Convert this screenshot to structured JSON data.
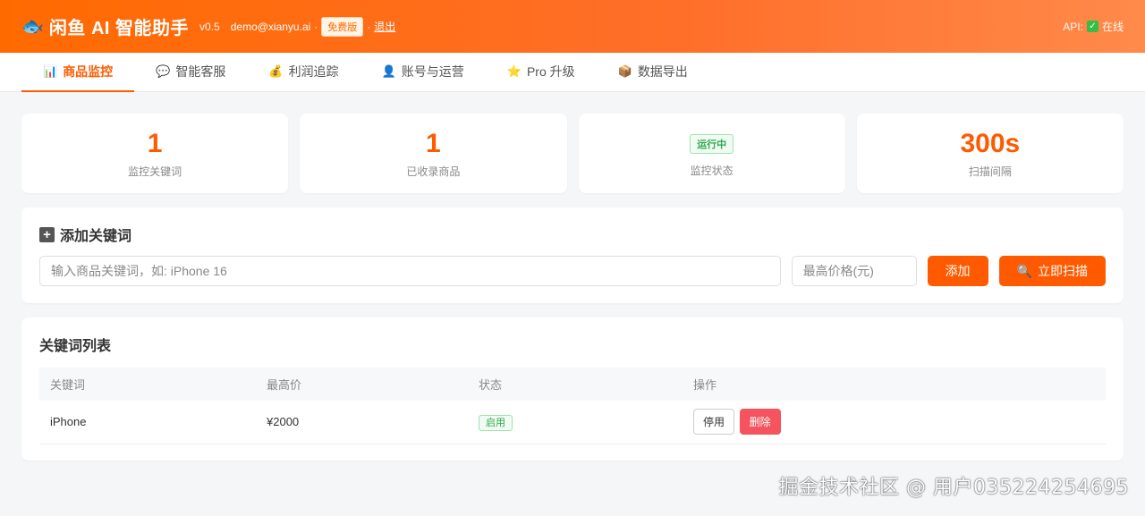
{
  "header": {
    "logo_icon": "fish-icon",
    "app_title": "闲鱼 AI 智能助手",
    "version": "v0.5",
    "email": "demo@xianyu.ai",
    "separator": "·",
    "plan_badge": "免费版",
    "logout_label": "退出",
    "api_label": "API:",
    "api_status": "在线",
    "api_icon": "check-icon"
  },
  "tabs": [
    {
      "icon": "📊",
      "icon_name": "chart-icon",
      "label": "商品监控",
      "active": true
    },
    {
      "icon": "💬",
      "icon_name": "chat-icon",
      "label": "智能客服",
      "active": false
    },
    {
      "icon": "💰",
      "icon_name": "money-bag-icon",
      "label": "利润追踪",
      "active": false
    },
    {
      "icon": "👤",
      "icon_name": "user-icon",
      "label": "账号与运营",
      "active": false
    },
    {
      "icon": "⭐",
      "icon_name": "star-icon",
      "label": "Pro 升级",
      "active": false
    },
    {
      "icon": "📦",
      "icon_name": "package-icon",
      "label": "数据导出",
      "active": false
    }
  ],
  "stats": [
    {
      "value": "1",
      "label": "监控关键词"
    },
    {
      "value": "1",
      "label": "已收录商品"
    },
    {
      "badge": "运行中",
      "label": "监控状态"
    },
    {
      "value": "300s",
      "label": "扫描间隔"
    }
  ],
  "add_keyword": {
    "title_icon": "plus-icon",
    "title": "添加关键词",
    "keyword_placeholder": "输入商品关键词，如: iPhone 16",
    "price_placeholder": "最高价格(元)",
    "add_button": "添加",
    "scan_button": "立即扫描",
    "scan_icon": "search-icon"
  },
  "keyword_list": {
    "title": "关键词列表",
    "columns": [
      "关键词",
      "最高价",
      "状态",
      "操作"
    ],
    "rows": [
      {
        "keyword": "iPhone",
        "max_price": "¥2000",
        "status": "启用",
        "disable_label": "停用",
        "delete_label": "删除"
      }
    ]
  },
  "watermark": "掘金技术社区 @ 用户035224254695",
  "colors": {
    "accent": "#ff5a00",
    "header_gradient_start": "#ff6a00",
    "success": "#2fa84f",
    "danger": "#f5535e"
  }
}
